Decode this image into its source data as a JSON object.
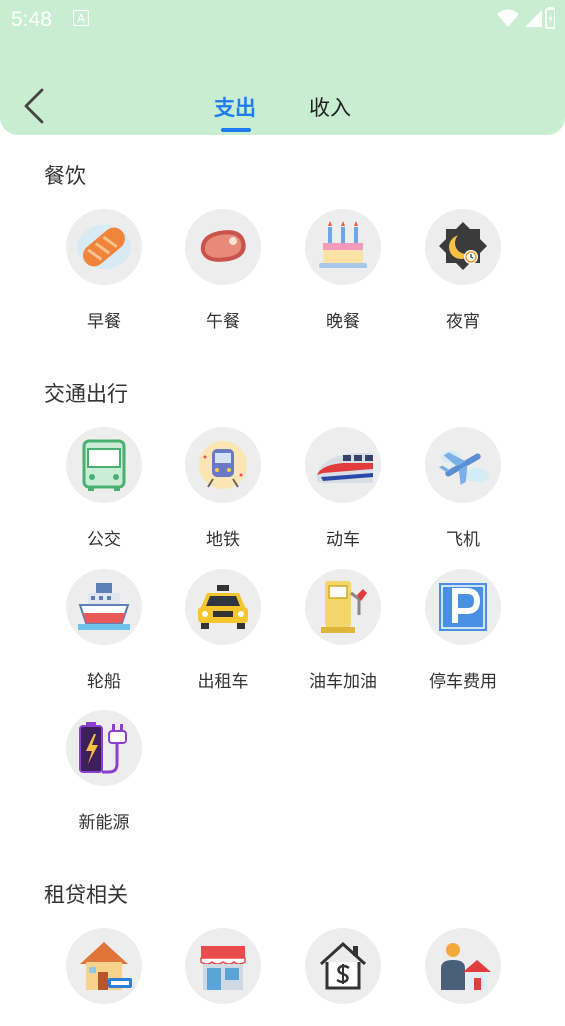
{
  "status": {
    "time": "5:48",
    "notif_icon_letter": "A",
    "icons": [
      "wifi-icon",
      "cell-signal-icon",
      "battery-icon"
    ]
  },
  "header": {
    "back_icon": "chevron-left-icon",
    "tabs": [
      {
        "label": "支出",
        "active": true
      },
      {
        "label": "收入",
        "active": false
      }
    ]
  },
  "sections": [
    {
      "title": "餐饮",
      "items": [
        {
          "label": "早餐",
          "icon": "bread-icon"
        },
        {
          "label": "午餐",
          "icon": "meat-icon"
        },
        {
          "label": "晚餐",
          "icon": "cake-icon"
        },
        {
          "label": "夜宵",
          "icon": "night-icon"
        }
      ]
    },
    {
      "title": "交通出行",
      "items": [
        {
          "label": "公交",
          "icon": "bus-icon"
        },
        {
          "label": "地铁",
          "icon": "subway-icon"
        },
        {
          "label": "动车",
          "icon": "bullet-train-icon"
        },
        {
          "label": "飞机",
          "icon": "airplane-icon"
        },
        {
          "label": "轮船",
          "icon": "ship-icon"
        },
        {
          "label": "出租车",
          "icon": "taxi-icon"
        },
        {
          "label": "油车加油",
          "icon": "fuel-pump-icon"
        },
        {
          "label": "停车费用",
          "icon": "parking-icon"
        },
        {
          "label": "新能源",
          "icon": "ev-charging-icon"
        }
      ]
    },
    {
      "title": "租贷相关",
      "items": [
        {
          "label": "",
          "icon": "house-rent-icon"
        },
        {
          "label": "",
          "icon": "shop-icon"
        },
        {
          "label": "",
          "icon": "house-dollar-icon"
        },
        {
          "label": "",
          "icon": "person-house-icon"
        }
      ]
    }
  ],
  "colors": {
    "header_bg": "#c8edd1",
    "accent": "#1e7cf2"
  }
}
